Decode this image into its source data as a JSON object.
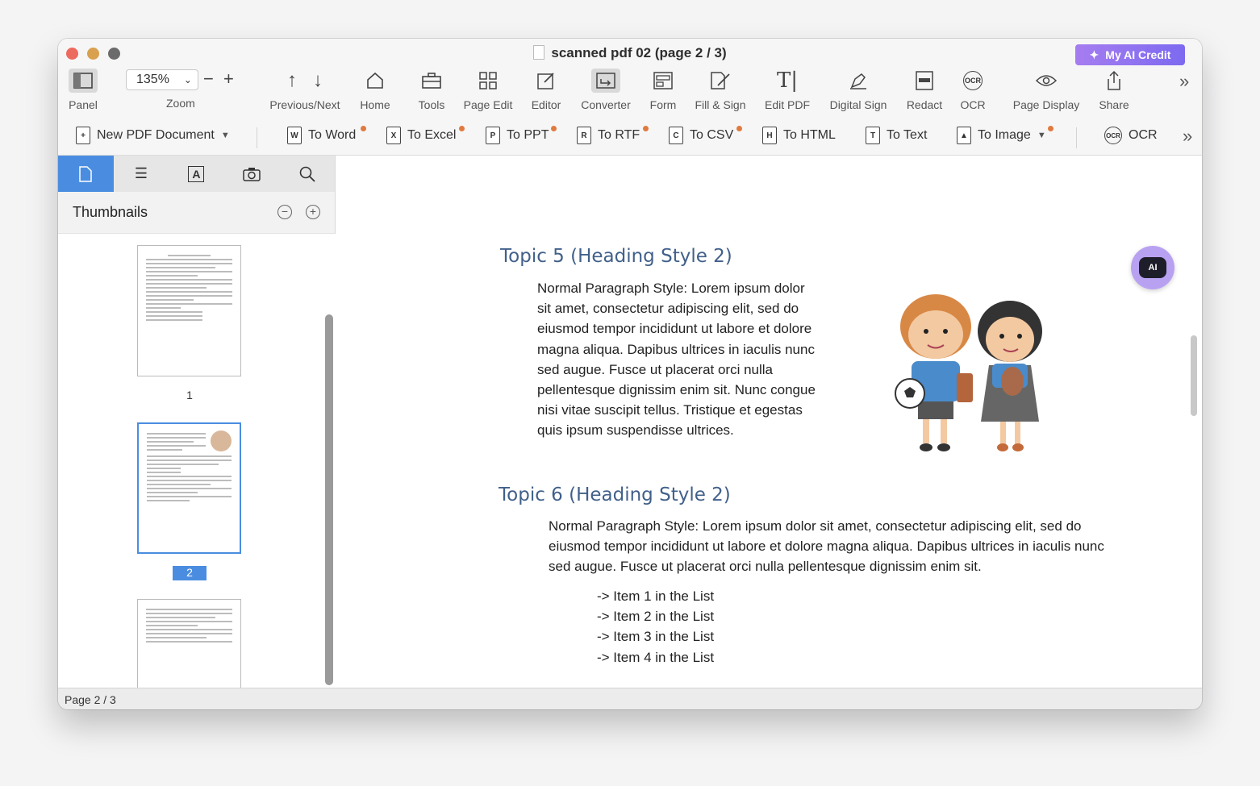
{
  "window": {
    "title": "scanned pdf 02 (page 2 / 3)"
  },
  "ai_credit": {
    "label": "My AI Credit"
  },
  "zoom": {
    "value": "135%",
    "label": "Zoom"
  },
  "toolbar": {
    "panel": "Panel",
    "prev_next": "Previous/Next",
    "home": "Home",
    "tools": "Tools",
    "page_edit": "Page Edit",
    "editor": "Editor",
    "converter": "Converter",
    "form": "Form",
    "fill_sign": "Fill & Sign",
    "edit_pdf": "Edit PDF",
    "digital_sign": "Digital Sign",
    "redact": "Redact",
    "ocr": "OCR",
    "page_display": "Page Display",
    "share": "Share"
  },
  "converter_bar": {
    "new_pdf": "New PDF Document",
    "to_word": "To Word",
    "to_excel": "To Excel",
    "to_ppt": "To PPT",
    "to_rtf": "To RTF",
    "to_csv": "To CSV",
    "to_html": "To HTML",
    "to_text": "To Text",
    "to_image": "To Image",
    "ocr": "OCR"
  },
  "sidebar": {
    "title": "Thumbnails",
    "pages": [
      "1",
      "2"
    ]
  },
  "status": {
    "page": "Page 2 / 3"
  },
  "document": {
    "topic5_heading": "Topic 5 (Heading Style 2)",
    "topic5_para": "Normal Paragraph Style: Lorem ipsum dolor sit amet, consectetur adipiscing elit, sed do eiusmod tempor incididunt ut labore et dolore magna aliqua. Dapibus ultrices in iaculis nunc sed augue. Fusce ut placerat orci nulla pellentesque dignissim enim sit. Nunc congue nisi vitae suscipit tellus. Tristique et egestas quis ipsum suspendisse ultrices.",
    "topic6_heading": "Topic 6 (Heading Style 2)",
    "topic6_para": "Normal Paragraph Style: Lorem ipsum dolor sit amet, consectetur adipiscing elit, sed do eiusmod tempor incididunt ut labore et dolore magna aliqua. Dapibus ultrices in iaculis nunc sed augue. Fusce ut placerat orci nulla pellentesque dignissim enim sit.",
    "list": [
      "-> Item 1 in the List",
      "-> Item 2 in the List",
      "-> Item 3 in the List",
      "-> Item 4 in the List"
    ]
  }
}
